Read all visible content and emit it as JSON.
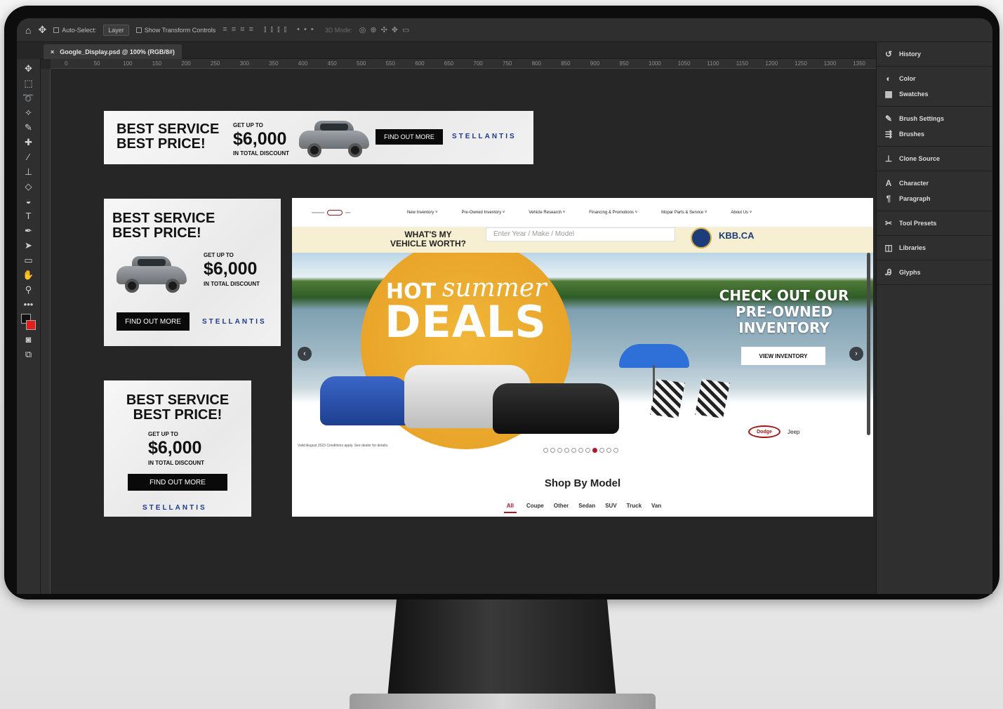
{
  "options_bar": {
    "auto_select_label": "Auto-Select:",
    "auto_select_value": "Layer",
    "show_transform_label": "Show Transform Controls",
    "mode_label": "3D Mode:"
  },
  "document": {
    "tab_title": "Google_Display.psd @ 100% (RGB/8#)"
  },
  "ruler_ticks": [
    "0",
    "50",
    "100",
    "150",
    "200",
    "250",
    "300",
    "350",
    "400",
    "450",
    "500",
    "550",
    "600",
    "650",
    "700",
    "750",
    "800",
    "850",
    "900",
    "950",
    "1000",
    "1050",
    "1100",
    "1150",
    "1200",
    "1250",
    "1300",
    "1350"
  ],
  "panels": {
    "items": [
      {
        "label": "History"
      },
      {
        "label": "Color"
      },
      {
        "label": "Swatches"
      },
      {
        "label": "Brush Settings"
      },
      {
        "label": "Brushes"
      },
      {
        "label": "Clone Source"
      },
      {
        "label": "Character"
      },
      {
        "label": "Paragraph"
      },
      {
        "label": "Tool Presets"
      },
      {
        "label": "Libraries"
      },
      {
        "label": "Glyphs"
      }
    ]
  },
  "ad": {
    "headline_1": "BEST SERVICE",
    "headline_2": "BEST PRICE!",
    "get_up_to": "GET UP TO",
    "price": "$6,000",
    "discount": "IN TOTAL DISCOUNT",
    "cta": "FIND OUT MORE",
    "brand": "STELLANTIS"
  },
  "site": {
    "nav": [
      "New Inventory ˅",
      "Pre-Owned Inventory ˅",
      "Vehicle Research ˅",
      "Financing & Promotions ˅",
      "Mopar Parts & Service ˅",
      "About Us ˅"
    ],
    "kbb_question_1": "WHAT'S MY",
    "kbb_question_2": "VEHICLE WORTH?",
    "kbb_placeholder": "Enter Year / Make / Model",
    "kbb_brand": "KBB.CA",
    "hero": {
      "hot": "HOT",
      "summer": "summer",
      "deals": "DEALS",
      "check_1": "CHECK OUT OUR",
      "check_2": "PRE-OWNED",
      "check_3": "INVENTORY",
      "cta": "VIEW INVENTORY",
      "legal": "Valid August 2023 Conditions apply. See dealer for details.",
      "dealer": "Dodge",
      "jeep": "Jeep",
      "prev": "‹",
      "next": "›"
    },
    "shop_title": "Shop By Model",
    "model_tabs": [
      "All",
      "Coupe",
      "Other",
      "Sedan",
      "SUV",
      "Truck",
      "Van"
    ]
  }
}
